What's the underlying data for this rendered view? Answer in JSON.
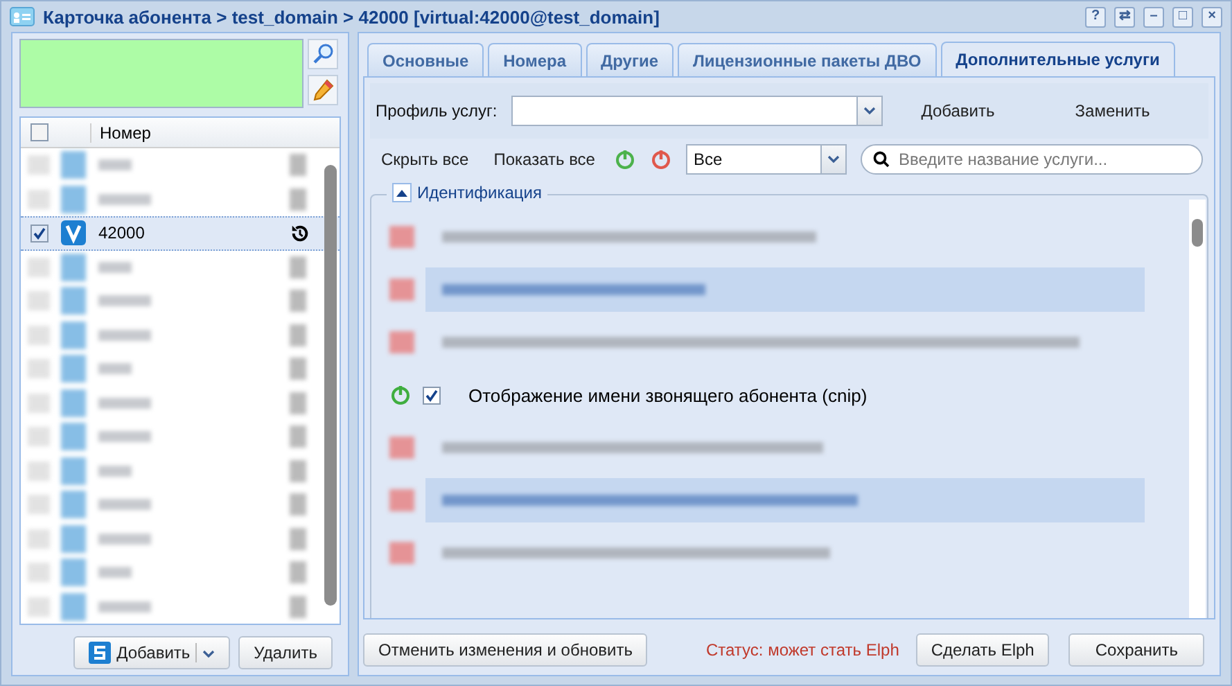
{
  "window": {
    "title": "Карточка абонента > test_domain > 42000 [virtual:42000@test_domain]",
    "controls": [
      "?",
      "⇄",
      "–",
      "□",
      "×"
    ]
  },
  "left_panel": {
    "table": {
      "column": "Номер",
      "header_checked": false,
      "rows": [
        {
          "kind": "redacted"
        },
        {
          "kind": "redacted"
        },
        {
          "kind": "number",
          "number": "42000",
          "checked": true,
          "selected": true
        },
        {
          "kind": "redacted"
        },
        {
          "kind": "redacted"
        },
        {
          "kind": "redacted"
        },
        {
          "kind": "redacted"
        },
        {
          "kind": "redacted"
        },
        {
          "kind": "redacted"
        },
        {
          "kind": "redacted"
        },
        {
          "kind": "redacted"
        },
        {
          "kind": "redacted"
        },
        {
          "kind": "redacted"
        },
        {
          "kind": "redacted"
        }
      ]
    },
    "buttons": [
      "Добавить",
      "Удалить"
    ]
  },
  "tabs": [
    {
      "label": "Основные",
      "selected": false
    },
    {
      "label": "Номера",
      "selected": false
    },
    {
      "label": "Другие",
      "selected": false
    },
    {
      "label": "Лицензионные пакеты ДВО",
      "selected": false
    },
    {
      "label": "Дополнительные услуги",
      "selected": true
    }
  ],
  "profile": {
    "label": "Профиль услуг:",
    "actions": [
      "Добавить",
      "Заменить"
    ]
  },
  "toolbar": {
    "hide_all": "Скрыть все",
    "show_all": "Показать все",
    "filter": "Все",
    "search_placeholder": "Введите название услуги..."
  },
  "group": {
    "title": "Идентификация",
    "expanded": true,
    "services": [
      {
        "kind": "redacted",
        "highlighted": false
      },
      {
        "kind": "redacted",
        "highlighted": true
      },
      {
        "kind": "redacted",
        "highlighted": false
      },
      {
        "kind": "service",
        "label": "Отображение имени звонящего абонента (cnip)",
        "on": true,
        "checked": true
      },
      {
        "kind": "redacted",
        "highlighted": false
      },
      {
        "kind": "redacted",
        "highlighted": true
      },
      {
        "kind": "redacted",
        "highlighted": false
      }
    ]
  },
  "footer": {
    "revert": "Отменить изменения и обновить",
    "status": "Статус: может стать Elph",
    "make": "Сделать Elph",
    "save": "Сохранить"
  }
}
